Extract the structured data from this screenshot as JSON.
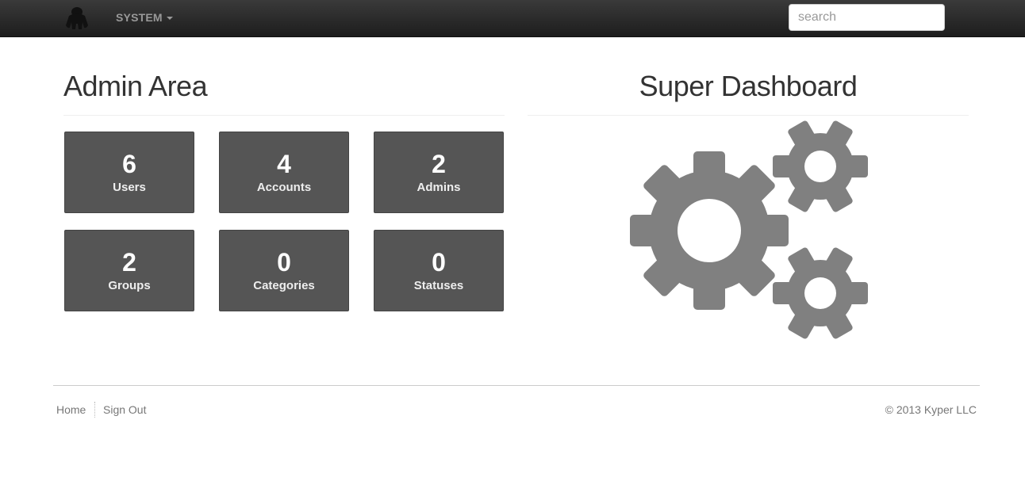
{
  "navbar": {
    "logo_icon": "gorilla-logo-icon",
    "system_menu_label": "SYSTEM",
    "search_placeholder": "search"
  },
  "admin": {
    "title": "Admin Area",
    "tiles": [
      {
        "count": "6",
        "label": "Users"
      },
      {
        "count": "4",
        "label": "Accounts"
      },
      {
        "count": "2",
        "label": "Admins"
      },
      {
        "count": "2",
        "label": "Groups"
      },
      {
        "count": "0",
        "label": "Categories"
      },
      {
        "count": "0",
        "label": "Statuses"
      }
    ]
  },
  "dashboard": {
    "title": "Super Dashboard",
    "icon": "gears-icon"
  },
  "footer": {
    "home_label": "Home",
    "signout_label": "Sign Out",
    "copyright": "© 2013 Kyper LLC"
  },
  "colors": {
    "navbar": "#222222",
    "tile": "#555555",
    "gear": "#808080"
  }
}
